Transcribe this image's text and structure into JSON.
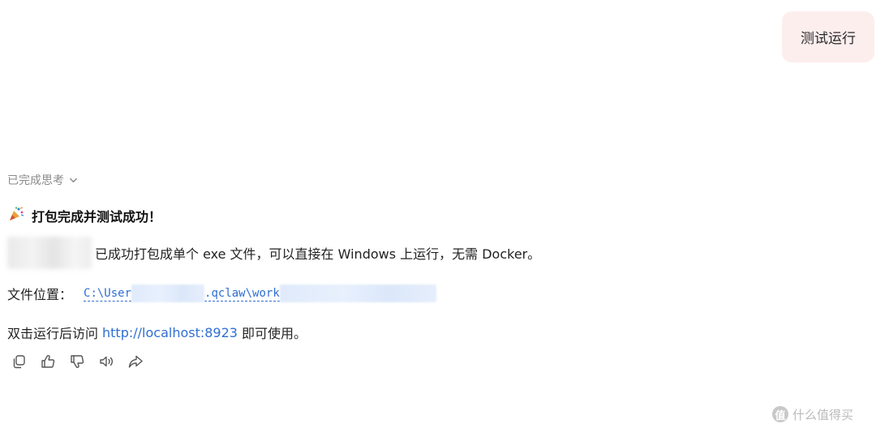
{
  "user_message": {
    "text": "测试运行"
  },
  "thinking": {
    "label": "已完成思考",
    "icon": "chevron-down-icon"
  },
  "reply": {
    "headline_icon": "party-popper-icon",
    "headline": "打包完成并测试成功！",
    "line1_text": "已成功打包成单个 exe 文件，可以直接在 Windows 上运行，无需 Docker。",
    "line2_label": "文件位置：",
    "path_start": "C:\\User",
    "path_mid": ".qclaw\\work",
    "line3_prefix": "双击运行后访问",
    "url": "http://localhost:8923",
    "line3_suffix": "即可使用。"
  },
  "actions": [
    {
      "icon": "copy-icon"
    },
    {
      "icon": "thumbs-up-icon"
    },
    {
      "icon": "thumbs-down-icon"
    },
    {
      "icon": "speaker-icon"
    },
    {
      "icon": "share-icon"
    }
  ],
  "watermark": {
    "logo_char": "值",
    "text": "什么值得买"
  },
  "colors": {
    "user_bubble": "#fdeeee",
    "link": "#2f6fd1",
    "muted": "#8a8a8a"
  }
}
